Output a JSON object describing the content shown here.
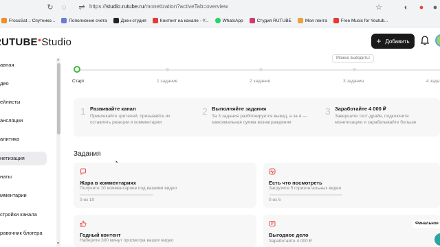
{
  "browser": {
    "url_prefix": "https://",
    "url_host": "studio.rutube.ru",
    "url_path": "/monetization?activeTab=overview",
    "bookmarks": [
      {
        "label": "FrocuSat .: Спутнико...",
        "color": "#f28b2c"
      },
      {
        "label": "Пополнение счета",
        "color": "#6b7bd6"
      },
      {
        "label": "Дзен-студия",
        "color": "#222222"
      },
      {
        "label": "Контент на канале - Y...",
        "color": "#e53935"
      },
      {
        "label": "WhatsApp",
        "color": "#25d366"
      },
      {
        "label": "Студия RUTUBE",
        "color": "#d13a6f"
      },
      {
        "label": "Моя лента",
        "color": "#e9a23b"
      },
      {
        "label": "Free Music for Youtub...",
        "color": "#e53935"
      }
    ]
  },
  "header": {
    "logo_main": "RUTUBE",
    "logo_sub": "Studio",
    "add_button": "Добавить"
  },
  "sidebar": {
    "items": [
      {
        "label": "авная"
      },
      {
        "label": "део"
      },
      {
        "label": "ейлисты"
      },
      {
        "label": "ансляции"
      },
      {
        "label": "алитика"
      },
      {
        "label": "нетизация"
      },
      {
        "label": "наты"
      },
      {
        "label": "мментарии"
      },
      {
        "label": "стройки канала"
      },
      {
        "label": "равочник блогера"
      }
    ]
  },
  "progress": {
    "tooltip": "Можно выводить!",
    "steps": [
      "Старт",
      "1 задание",
      "2 задания",
      "3 задания",
      "4 зада"
    ]
  },
  "info": [
    {
      "num": "1",
      "title": "Развивайте канал",
      "text": "Привлекайте зрителей, призывайте их оставлять реакции и комментарии"
    },
    {
      "num": "2",
      "title": "Выполняйте задания",
      "text": "За 3 задания разблокируется вывод, а за 4 — максимальная сумма вознаграждения"
    },
    {
      "num": "3",
      "title": "Заработайте 4 000 ₽",
      "text": "Завершите тест-драйв, подключите монетизацию и зарабатывайте больше"
    }
  ],
  "tasks_title": "Задания",
  "cards": [
    {
      "title": "Жара в комментариях",
      "desc": "Получите 10 комментариев под вашими видео",
      "count": "0 из 10"
    },
    {
      "title": "Есть что посмотреть",
      "desc": "Загрузите 5 горизонтальных видео",
      "count": "0 из 5"
    },
    {
      "title": "Годный контент",
      "desc": "Наберите 300 минут просмотра ваших видео",
      "count": ""
    },
    {
      "title": "Выгодное дело",
      "desc": "Заработайте 4 000 ₽",
      "count": ""
    }
  ],
  "final_badge": "Финальное",
  "colors": {
    "accent": "#f2413c",
    "progress_start": "#3dbb3d",
    "button_bg": "#1a1a1a"
  }
}
